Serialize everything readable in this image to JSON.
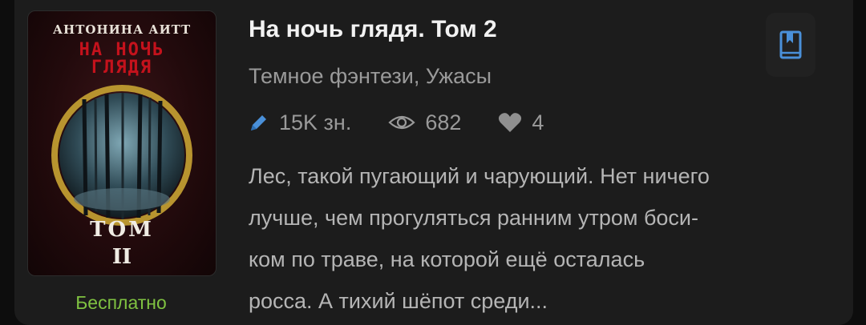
{
  "book": {
    "cover": {
      "author": "АНТОНИНА АИТТ",
      "title_line1": "НА НОЧЬ",
      "title_line2": "ГЛЯДЯ",
      "volume_word": "ТОМ",
      "volume_number": "II"
    },
    "price": "Бесплатно",
    "title": "На ночь глядя. Том 2",
    "genres": "Темное фэнтези, Ужасы",
    "stats": {
      "length": "15K зн.",
      "views": "682",
      "likes": "4"
    },
    "description_lines": [
      "Лес, такой пугающий и чарующий. Нет ничего",
      "лучше, чем прогуляться ранним утром боси-",
      "ком по траве, на которой ещё осталась",
      "росса. А тихий шёпот среди..."
    ]
  },
  "icons": {
    "length": "pencil-icon",
    "views": "eye-icon",
    "likes": "heart-icon",
    "bookmark": "bookmark-icon"
  },
  "colors": {
    "background": "#1c1c1c",
    "price": "#7fc241",
    "accent": "#4a90d9",
    "title": "#f2f2f2",
    "muted": "#9a9a9a"
  }
}
